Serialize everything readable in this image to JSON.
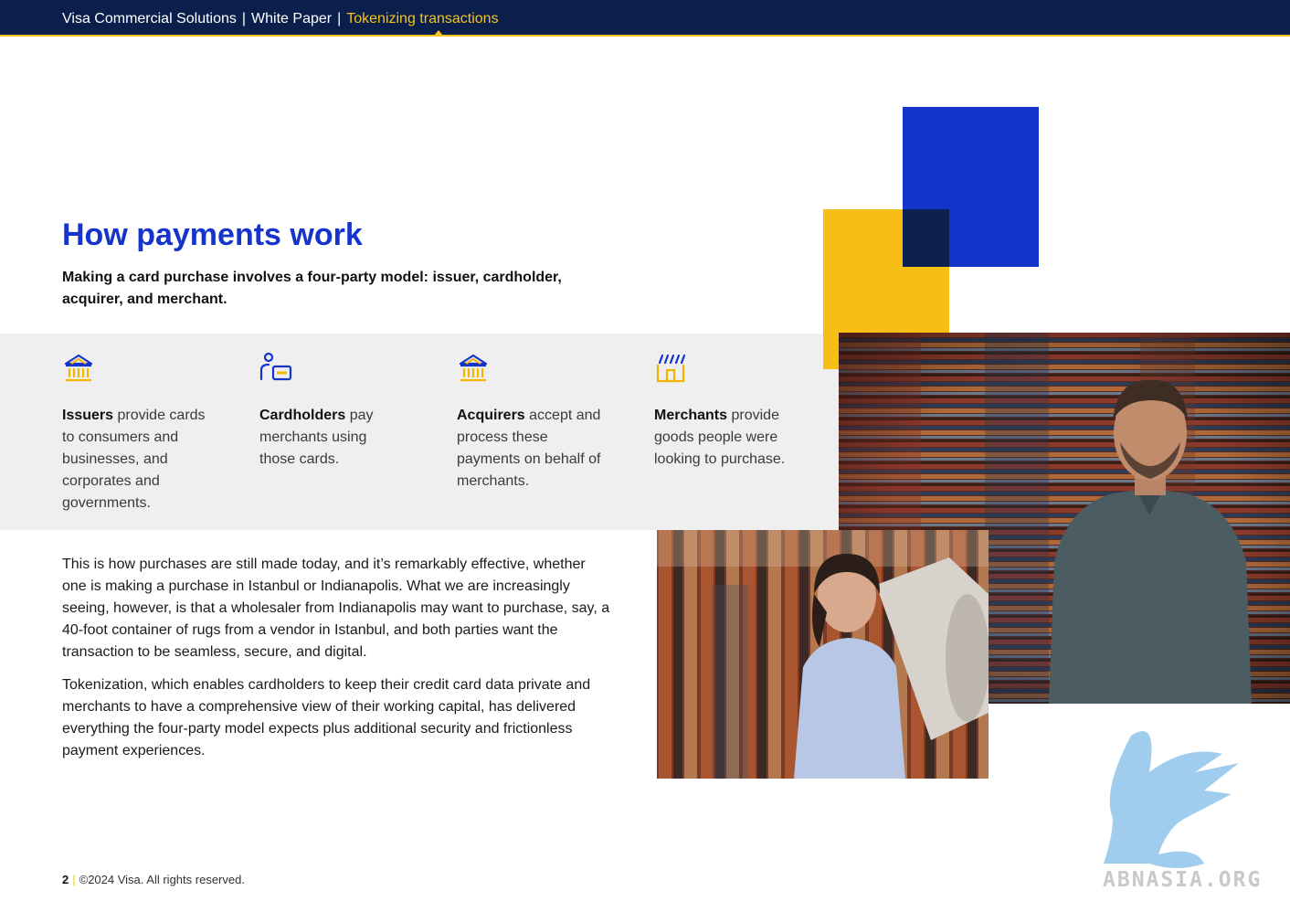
{
  "header": {
    "crumbs": [
      "Visa Commercial Solutions",
      "White Paper",
      "Tokenizing transactions"
    ],
    "separator": "|"
  },
  "section": {
    "title": "How payments work",
    "subtitle": "Making a card purchase involves a four-party model: issuer, cardholder, acquirer, and merchant."
  },
  "parties": [
    {
      "icon": "bank-icon",
      "name": "Issuers",
      "description": "provide cards to consumers and businesses, and corporates and governments."
    },
    {
      "icon": "cardholder-icon",
      "name": "Cardholders",
      "description": "pay merchants using those cards."
    },
    {
      "icon": "bank-icon",
      "name": "Acquirers",
      "description": "accept and process these payments on behalf of merchants."
    },
    {
      "icon": "merchant-store-icon",
      "name": "Merchants",
      "description": "provide goods people were looking to purchase."
    }
  ],
  "body": {
    "paragraphs": [
      "This is how purchases are still made today, and it’s remarkably effective, whether one is making a purchase in Istanbul or Indianapolis. What we are increasingly seeing, however, is that a wholesaler from Indianapolis may want to purchase, say, a 40-foot container of rugs from a vendor in Istanbul, and both parties want the transaction to be seamless, secure, and digital.",
      "Tokenization, which enables cardholders to keep their credit card data private and merchants to have a comprehensive view of their working capital, has delivered everything the four-party model expects plus additional security and frictionless payment experiences."
    ]
  },
  "footer": {
    "page": "2",
    "separator": "|",
    "copyright": "©2024 Visa. All rights reserved."
  },
  "watermark": {
    "text": "ABNASIA.ORG"
  },
  "colors": {
    "navy": "#0b1f4d",
    "visa_blue": "#1434cb",
    "visa_yellow": "#f7bf16",
    "band_grey": "#efefef"
  }
}
